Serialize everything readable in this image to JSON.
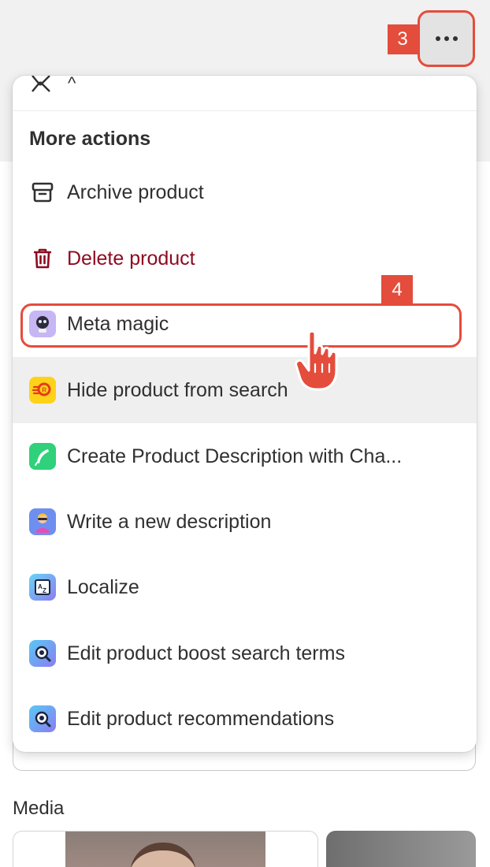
{
  "annotations": {
    "step3": "3",
    "step4": "4"
  },
  "menu": {
    "heading": "More actions",
    "peek_text": "^",
    "items": [
      {
        "label": "Archive product",
        "icon": "archive-icon"
      },
      {
        "label": "Delete product",
        "icon": "trash-icon",
        "color": "#8e0b21"
      },
      {
        "label": "Meta magic",
        "icon": "meta-magic-app-icon"
      },
      {
        "label": "Hide product from search",
        "icon": "hide-from-search-app-icon"
      },
      {
        "label": "Create Product Description with Cha...",
        "icon": "chatgpt-description-app-icon"
      },
      {
        "label": "Write a new description",
        "icon": "write-description-app-icon"
      },
      {
        "label": "Localize",
        "icon": "localize-app-icon"
      },
      {
        "label": "Edit product boost search terms",
        "icon": "search-boost-app-icon"
      },
      {
        "label": "Edit product recommendations",
        "icon": "recommendations-app-icon"
      }
    ]
  },
  "page": {
    "media_heading": "Media"
  },
  "colors": {
    "annotation": "#e44c3c",
    "danger": "#8e0b21",
    "hover": "#efefef"
  }
}
